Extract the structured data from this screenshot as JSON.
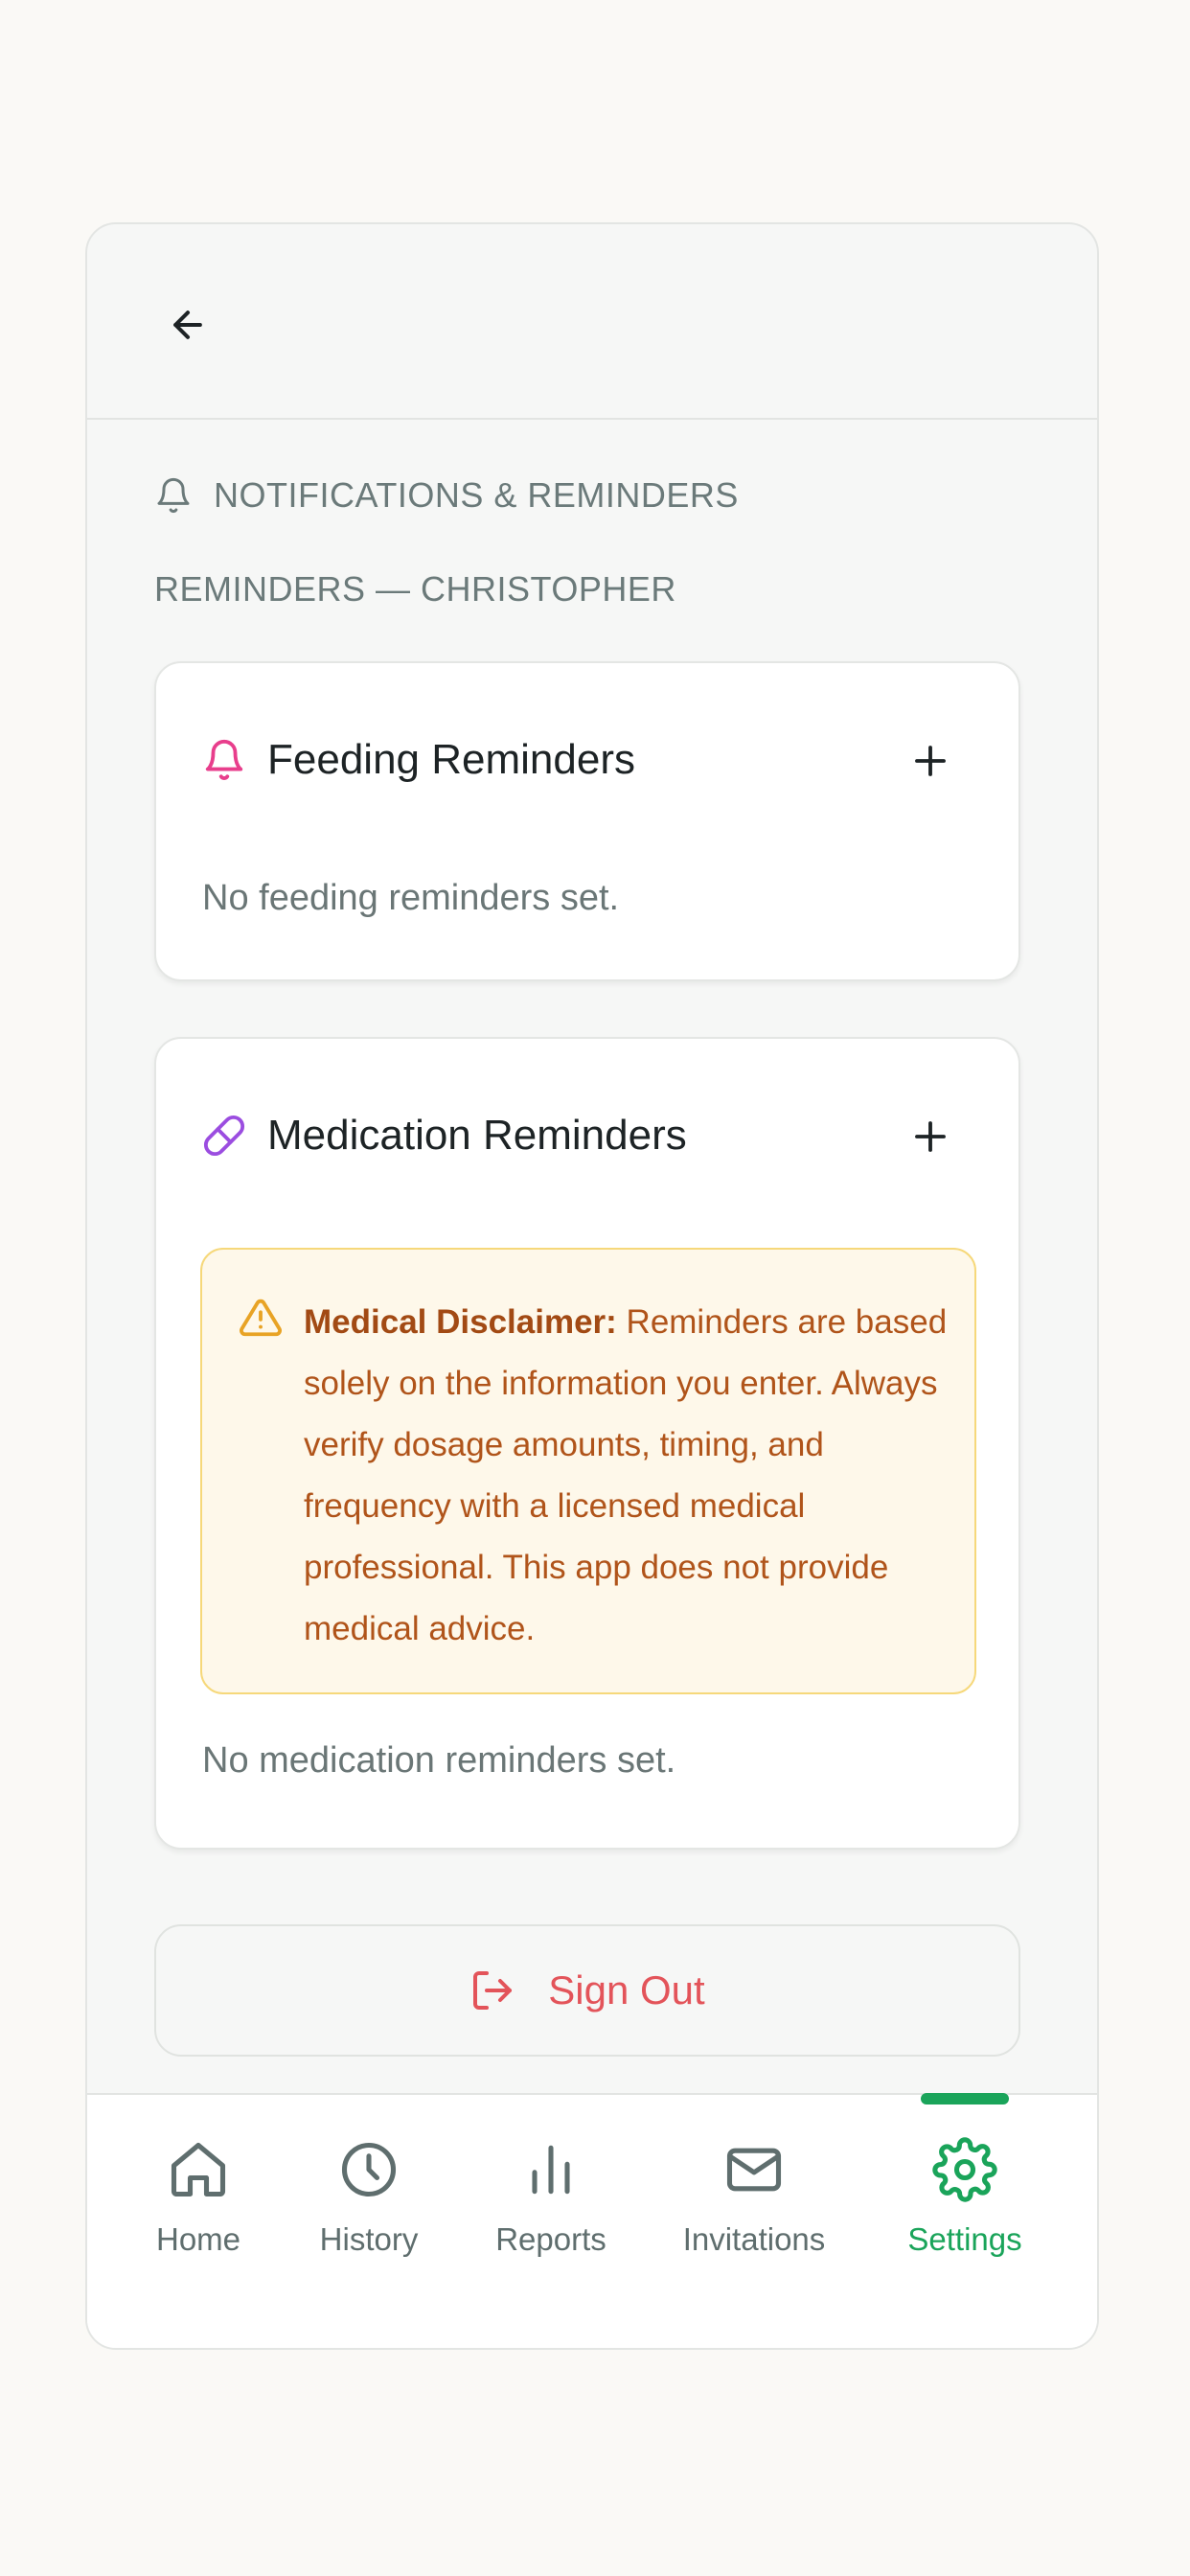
{
  "header": {
    "back_icon": "arrow-left-icon"
  },
  "section": {
    "icon": "bell-icon",
    "title": "NOTIFICATIONS & REMINDERS",
    "subtitle": "REMINDERS — CHRISTOPHER"
  },
  "feeding": {
    "icon": "bell-icon",
    "title": "Feeding Reminders",
    "add_icon": "plus-icon",
    "empty": "No feeding reminders set."
  },
  "medication": {
    "icon": "pill-icon",
    "title": "Medication Reminders",
    "add_icon": "plus-icon",
    "disclaimer_label": "Medical Disclaimer:",
    "disclaimer_text": " Reminders are based solely on the information you enter. Always verify dosage amounts, timing, and frequency with a licensed medical professional. This app does not provide medical advice.",
    "empty": "No medication reminders set."
  },
  "signout": {
    "icon": "sign-out-icon",
    "label": "Sign Out"
  },
  "nav": {
    "items": [
      {
        "label": "Home",
        "icon": "home-icon"
      },
      {
        "label": "History",
        "icon": "clock-icon"
      },
      {
        "label": "Reports",
        "icon": "bar-chart-icon"
      },
      {
        "label": "Invitations",
        "icon": "mail-icon"
      },
      {
        "label": "Settings",
        "icon": "gear-icon"
      }
    ],
    "active": "Settings"
  },
  "colors": {
    "accent": "#1aa45a",
    "danger": "#e3545a",
    "feeding_icon": "#e83e8c",
    "medication_icon": "#9b4de0",
    "warning": "#e8a325"
  }
}
